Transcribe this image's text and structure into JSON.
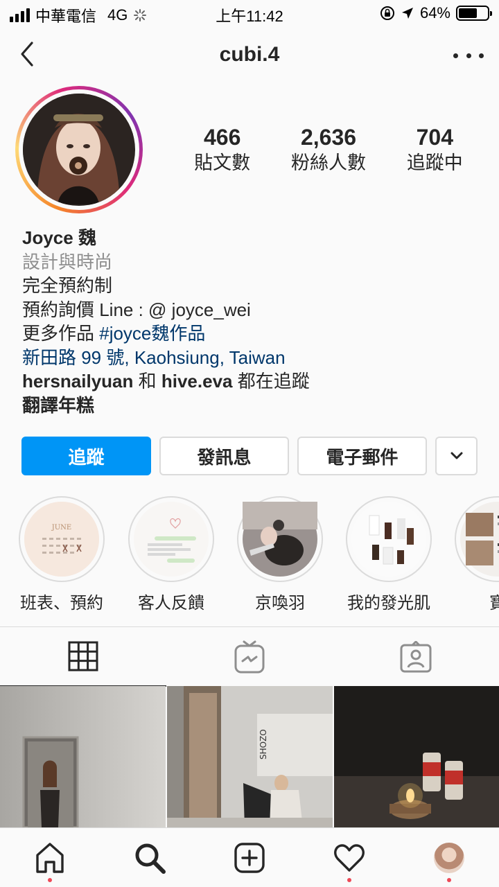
{
  "status_bar": {
    "carrier": "中華電信",
    "network": "4G",
    "time": "上午11:42",
    "battery_percent": "64%",
    "battery_level": 0.64
  },
  "nav": {
    "username": "cubi.4",
    "back_icon": "chevron-left-icon",
    "more_icon": "more-horizontal-icon"
  },
  "profile": {
    "stats": [
      {
        "value": "466",
        "label": "貼文數"
      },
      {
        "value": "2,636",
        "label": "粉絲人數"
      },
      {
        "value": "704",
        "label": "追蹤中"
      }
    ],
    "name": "Joyce 魏",
    "category": "設計與時尚",
    "bio_line1": "完全預約制",
    "bio_line2": "預約詢價 Line : @ joyce_wei",
    "bio_line3_prefix": "更多作品 ",
    "bio_hashtag": "#joyce魏作品",
    "address": "新田路 99 號, Kaohsiung, Taiwan",
    "followed_by_user1": "hersnailyuan",
    "followed_by_join": " 和 ",
    "followed_by_user2": "hive.eva",
    "followed_by_suffix": " 都在追蹤",
    "translate": "翻譯年糕"
  },
  "buttons": {
    "follow": "追蹤",
    "message": "發訊息",
    "email": "電子郵件"
  },
  "highlights": [
    {
      "label": "班表、預約"
    },
    {
      "label": "客人反饋"
    },
    {
      "label": "京喚羽"
    },
    {
      "label": "我的發光肌"
    },
    {
      "label": "寶"
    }
  ],
  "tabs": [
    "grid-icon",
    "igtv-icon",
    "tagged-icon"
  ],
  "bottom_nav": [
    "home-icon",
    "search-icon",
    "add-post-icon",
    "heart-icon",
    "profile-avatar"
  ],
  "colors": {
    "accent": "#0095f6",
    "link": "#00376b",
    "notification_dot": "#ed4956"
  }
}
